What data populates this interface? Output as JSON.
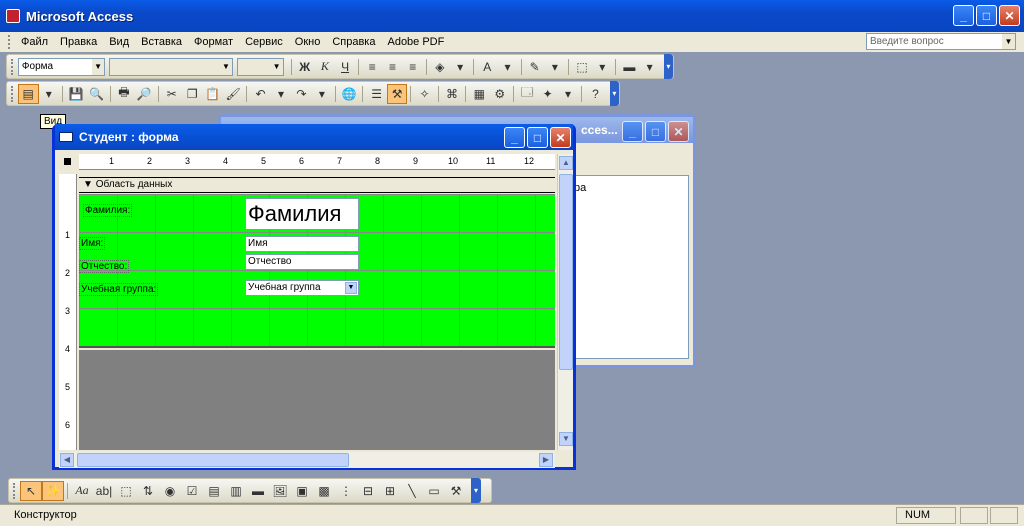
{
  "app": {
    "title": "Microsoft Access"
  },
  "menu": {
    "items": [
      "Файл",
      "Правка",
      "Вид",
      "Вставка",
      "Формат",
      "Сервис",
      "Окно",
      "Справка",
      "Adobe PDF"
    ],
    "ask_placeholder": "Введите вопрос"
  },
  "format_toolbar": {
    "object_combo": "Форма",
    "bold": "Ж",
    "italic": "К",
    "underline": "Ч"
  },
  "tooltip": "Вид",
  "background_window": {
    "title_fragment": "cces...",
    "list_fragment": "ра"
  },
  "form_window": {
    "title": "Студент : форма",
    "ruler_h": [
      "1",
      "2",
      "3",
      "4",
      "5",
      "6",
      "7",
      "8",
      "9",
      "10",
      "11",
      "12"
    ],
    "ruler_v": [
      "1",
      "2",
      "3",
      "4",
      "5",
      "6"
    ],
    "section_header": "Область данных",
    "labels": {
      "surname": "Фамилия:",
      "name": "Имя:",
      "patronymic": "Отчество:",
      "group": "Учебная группа:"
    },
    "fields": {
      "surname": "Фамилия",
      "name": "Имя",
      "patronymic": "Отчество",
      "group": "Учебная группа"
    }
  },
  "toolbox": {
    "label_tool": "Aa",
    "textbox_tool": "ab|"
  },
  "status": {
    "text": "Конструктор",
    "num": "NUM"
  }
}
